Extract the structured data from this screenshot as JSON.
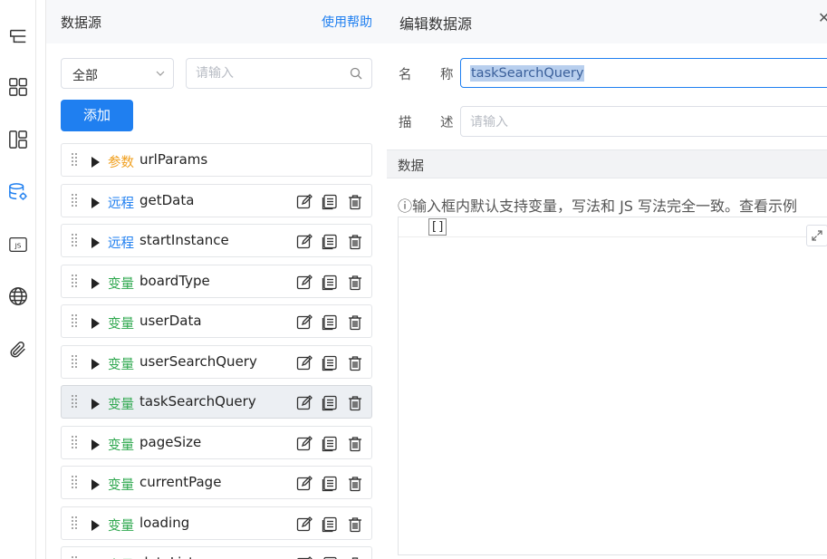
{
  "rail": {
    "icons": [
      "outline-icon",
      "components-icon",
      "layout-icon",
      "datasource-icon",
      "js-icon",
      "globe-icon",
      "attachment-icon"
    ],
    "active_index": 3,
    "js_label": "JS"
  },
  "datasource_panel": {
    "title": "数据源",
    "help_link": "使用帮助",
    "filter_value": "全部",
    "search_placeholder": "请输入",
    "add_button": "添加",
    "items": [
      {
        "type": "参数",
        "kind": "param",
        "name": "urlParams",
        "actions": false
      },
      {
        "type": "远程",
        "kind": "remote",
        "name": "getData",
        "actions": true
      },
      {
        "type": "远程",
        "kind": "remote",
        "name": "startInstance",
        "actions": true
      },
      {
        "type": "变量",
        "kind": "var",
        "name": "boardType",
        "actions": true
      },
      {
        "type": "变量",
        "kind": "var",
        "name": "userData",
        "actions": true
      },
      {
        "type": "变量",
        "kind": "var",
        "name": "userSearchQuery",
        "actions": true
      },
      {
        "type": "变量",
        "kind": "var",
        "name": "taskSearchQuery",
        "actions": true,
        "active": true
      },
      {
        "type": "变量",
        "kind": "var",
        "name": "pageSize",
        "actions": true
      },
      {
        "type": "变量",
        "kind": "var",
        "name": "currentPage",
        "actions": true
      },
      {
        "type": "变量",
        "kind": "var",
        "name": "loading",
        "actions": true
      },
      {
        "type": "变量",
        "kind": "var",
        "name": "dataList",
        "actions": true
      }
    ]
  },
  "editor": {
    "title": "编辑数据源",
    "close_icon": "✕",
    "name_label_1": "名",
    "name_label_2": "称",
    "name_value": "taskSearchQuery",
    "desc_label_1": "描",
    "desc_label_2": "述",
    "desc_placeholder": "请输入",
    "data_section": "数据",
    "hint": "ⓘ输入框内默认支持变量，写法和 JS 写法完全一致。查看示例",
    "code_value": "[]"
  },
  "colors": {
    "accent": "#1f7ff0",
    "param": "#f0a020",
    "remote": "#1f7ff0",
    "var": "#2fa84f"
  }
}
